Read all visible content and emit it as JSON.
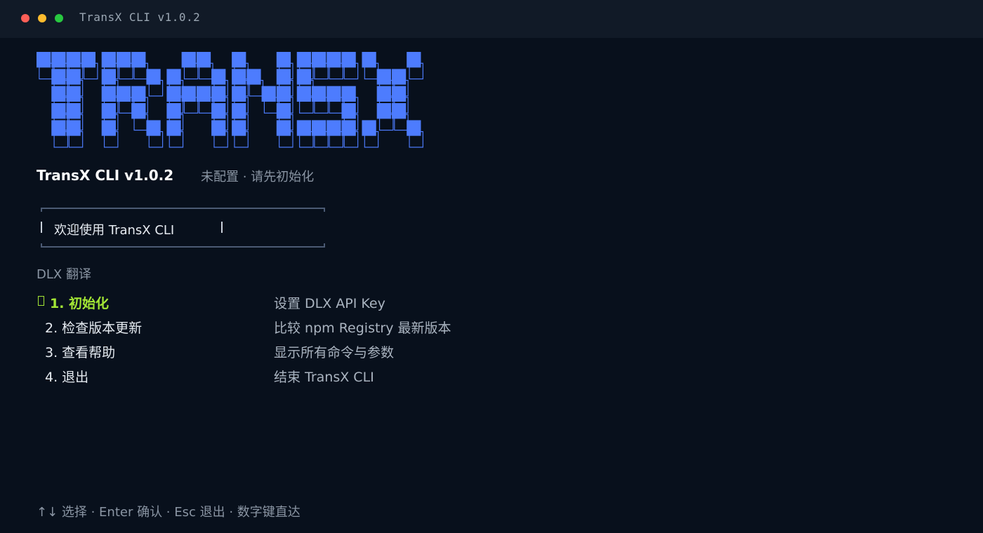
{
  "window": {
    "title": "TransX CLI v1.0.2"
  },
  "logo": {
    "text": "TRANSX",
    "color": "#4d7cfe",
    "outline_color": "#4d7cfe"
  },
  "header": {
    "app_name": "TransX CLI v1.0.2",
    "status": "未配置 · 请先初始化"
  },
  "welcome": {
    "text": "欢迎使用 TransX CLI"
  },
  "section": {
    "label": "DLX 翻译"
  },
  "menu": {
    "items": [
      {
        "label": "1. 初始化",
        "description": "设置 DLX API Key",
        "active": true
      },
      {
        "label": "2. 检查版本更新",
        "description": "比较 npm Registry 最新版本",
        "active": false
      },
      {
        "label": "3. 查看帮助",
        "description": "显示所有命令与参数",
        "active": false
      },
      {
        "label": "4. 退出",
        "description": "结束 TransX CLI",
        "active": false
      }
    ]
  },
  "footer": {
    "hint": "↑↓ 选择 · Enter 确认 · Esc 退出 · 数字键直达"
  },
  "colors": {
    "background": "#08101c",
    "titlebar": "#111a27",
    "accent_green": "#a3e635",
    "logo_blue": "#4d7cfe",
    "muted_text": "#8a95a3"
  }
}
